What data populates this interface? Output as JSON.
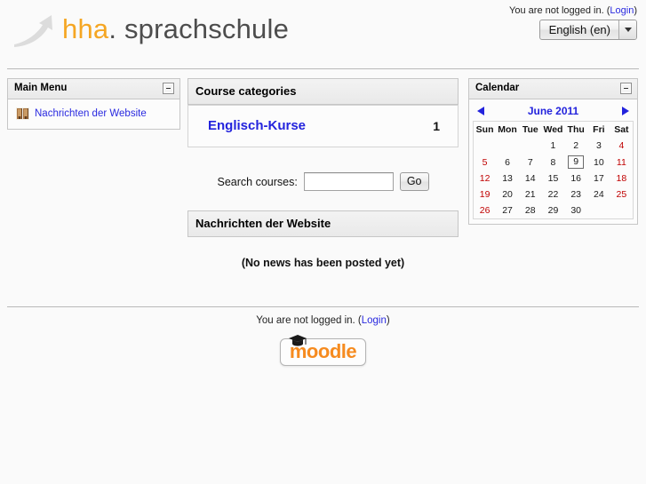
{
  "site": {
    "brand_prefix": "hha",
    "brand_dot": ".",
    "brand_rest": " sprachschule",
    "logo_icon": "growth-arrow-icon"
  },
  "header": {
    "login_status": "You are not logged in. (",
    "login_link": "Login",
    "login_status_close": ")",
    "language_selected": "English (en)"
  },
  "sidebar": {
    "title": "Main Menu",
    "collapse_icon": "collapse-minus-icon",
    "items": [
      {
        "label": "Nachrichten der Website",
        "icon": "forum-icon"
      }
    ]
  },
  "main": {
    "categories_block": {
      "title": "Course categories",
      "categories": [
        {
          "name": "Englisch-Kurse",
          "count": "1"
        }
      ]
    },
    "search": {
      "label": "Search courses:",
      "value": "",
      "placeholder": "",
      "button_label": "Go"
    },
    "news_block": {
      "title": "Nachrichten der Website",
      "empty_message": "(No news has been posted yet)"
    }
  },
  "calendar": {
    "title": "Calendar",
    "collapse_icon": "collapse-minus-icon",
    "prev_icon": "triangle-left-icon",
    "next_icon": "triangle-right-icon",
    "month_label": "June 2011",
    "weekday_headers": [
      "Sun",
      "Mon",
      "Tue",
      "Wed",
      "Thu",
      "Fri",
      "Sat"
    ],
    "weeks": [
      [
        {
          "day": "",
          "weekend": false,
          "today": false
        },
        {
          "day": "",
          "weekend": false,
          "today": false
        },
        {
          "day": "",
          "weekend": false,
          "today": false
        },
        {
          "day": "1",
          "weekend": false,
          "today": false
        },
        {
          "day": "2",
          "weekend": false,
          "today": false
        },
        {
          "day": "3",
          "weekend": false,
          "today": false
        },
        {
          "day": "4",
          "weekend": true,
          "today": false
        }
      ],
      [
        {
          "day": "5",
          "weekend": true,
          "today": false
        },
        {
          "day": "6",
          "weekend": false,
          "today": false
        },
        {
          "day": "7",
          "weekend": false,
          "today": false
        },
        {
          "day": "8",
          "weekend": false,
          "today": false
        },
        {
          "day": "9",
          "weekend": false,
          "today": true
        },
        {
          "day": "10",
          "weekend": false,
          "today": false
        },
        {
          "day": "11",
          "weekend": true,
          "today": false
        }
      ],
      [
        {
          "day": "12",
          "weekend": true,
          "today": false
        },
        {
          "day": "13",
          "weekend": false,
          "today": false
        },
        {
          "day": "14",
          "weekend": false,
          "today": false
        },
        {
          "day": "15",
          "weekend": false,
          "today": false
        },
        {
          "day": "16",
          "weekend": false,
          "today": false
        },
        {
          "day": "17",
          "weekend": false,
          "today": false
        },
        {
          "day": "18",
          "weekend": true,
          "today": false
        }
      ],
      [
        {
          "day": "19",
          "weekend": true,
          "today": false
        },
        {
          "day": "20",
          "weekend": false,
          "today": false
        },
        {
          "day": "21",
          "weekend": false,
          "today": false
        },
        {
          "day": "22",
          "weekend": false,
          "today": false
        },
        {
          "day": "23",
          "weekend": false,
          "today": false
        },
        {
          "day": "24",
          "weekend": false,
          "today": false
        },
        {
          "day": "25",
          "weekend": true,
          "today": false
        }
      ],
      [
        {
          "day": "26",
          "weekend": true,
          "today": false
        },
        {
          "day": "27",
          "weekend": false,
          "today": false
        },
        {
          "day": "28",
          "weekend": false,
          "today": false
        },
        {
          "day": "29",
          "weekend": false,
          "today": false
        },
        {
          "day": "30",
          "weekend": false,
          "today": false
        },
        {
          "day": "",
          "weekend": false,
          "today": false
        },
        {
          "day": "",
          "weekend": true,
          "today": false
        }
      ]
    ]
  },
  "footer": {
    "login_status": "You are not logged in. (",
    "login_link": "Login",
    "login_status_close": ")",
    "powered_by": "moodle"
  },
  "colors": {
    "brand_orange": "#f5a623",
    "brand_gray": "#4d4d4d",
    "link_blue": "#2a2ae0",
    "weekend_red": "#c00000",
    "moodle_orange": "#f68b1f"
  }
}
